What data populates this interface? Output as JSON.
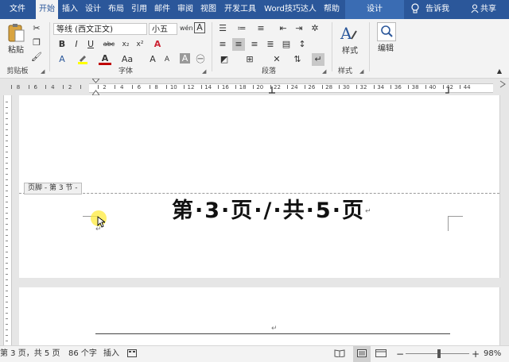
{
  "tabs": {
    "items": [
      "文件",
      "开始",
      "插入",
      "设计",
      "布局",
      "引用",
      "邮件",
      "审阅",
      "视图",
      "开发工具",
      "Word技巧达人",
      "帮助"
    ],
    "active": "开始",
    "context_tab": "设计",
    "tell_me": "告诉我",
    "share": "共享"
  },
  "ribbon": {
    "clipboard": {
      "paste": "粘贴",
      "label": "剪贴板"
    },
    "font": {
      "name": "等线 (西文正文)",
      "size": "小五",
      "pinyin": "wén",
      "label": "字体",
      "bold": "B",
      "italic": "I",
      "underline": "U",
      "strike": "abc",
      "subscript": "x₂",
      "superscript": "x²",
      "clear": "A",
      "font_color": "A",
      "case": "Aa",
      "grow": "A",
      "shrink": "A",
      "char_shade": "A"
    },
    "paragraph": {
      "label": "段落"
    },
    "styles": {
      "btn": "样式",
      "label": "样式"
    },
    "editing": {
      "btn": "编辑"
    }
  },
  "ruler": {
    "marks": [
      "8",
      "6",
      "4",
      "2",
      "",
      "2",
      "4",
      "6",
      "8",
      "10",
      "12",
      "14",
      "16",
      "18",
      "20",
      "22",
      "24",
      "26",
      "28",
      "30",
      "32",
      "34",
      "36",
      "38",
      "40",
      "42",
      "44"
    ]
  },
  "document": {
    "footer_tag": "页脚 - 第 3 节 -",
    "page_number_text": "第·3·页·/·共·5·页",
    "return_mark": "↵"
  },
  "statusbar": {
    "page": "第 3 页，共 5 页",
    "words": "86 个字",
    "mode": "插入",
    "zoom": "98%",
    "zoom_fraction": 0.52
  },
  "colors": {
    "accent": "#2b579a",
    "font_color_bar": "#c00000",
    "highlight_bar": "#ffff00"
  }
}
